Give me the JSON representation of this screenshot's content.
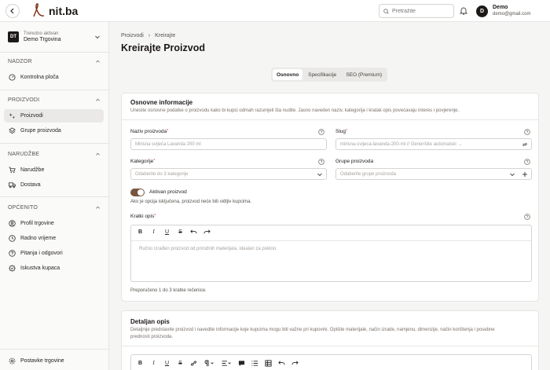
{
  "header": {
    "logo_text": "nit.ba",
    "search_placeholder": "Pretražite",
    "user_initial": "D",
    "user_name": "Demo",
    "user_email": "demo@gmail.com"
  },
  "sidebar": {
    "store_caption": "Trenutno aktivan",
    "store_name": "Demo Trgovina",
    "store_badge": "DT",
    "sections": [
      {
        "title": "NADZOR",
        "items": [
          {
            "label": "Kontrolna ploča",
            "icon": "gauge-icon"
          }
        ]
      },
      {
        "title": "PROIZVODI",
        "items": [
          {
            "label": "Proizvodi",
            "icon": "sparkle-icon",
            "active": true
          },
          {
            "label": "Grupe proizvoda",
            "icon": "layers-icon"
          }
        ]
      },
      {
        "title": "NARUDŽBE",
        "items": [
          {
            "label": "Narudžbe",
            "icon": "cart-icon"
          },
          {
            "label": "Dostava",
            "icon": "truck-icon"
          }
        ]
      },
      {
        "title": "OPĆENITO",
        "items": [
          {
            "label": "Profil trgovine",
            "icon": "user-circle-icon"
          },
          {
            "label": "Radno vrijeme",
            "icon": "clock-icon"
          },
          {
            "label": "Pitanja i odgovori",
            "icon": "question-icon"
          },
          {
            "label": "Iskustva kupaca",
            "icon": "badge-icon"
          }
        ]
      }
    ],
    "settings_label": "Postavke trgovine"
  },
  "main": {
    "breadcrumb": [
      "Proizvodi",
      "Kreirajte"
    ],
    "title": "Kreirajte Proizvod",
    "tabs": [
      {
        "label": "Osnovno",
        "active": true
      },
      {
        "label": "Specifikacije"
      },
      {
        "label": "SEO (Premium)"
      }
    ],
    "basic_card": {
      "title": "Osnovne informacije",
      "desc": "Unesite osnovne podatke o proizvodu kako bi kupci odmah razumjeli šta nudite. Jasno naveden naziv, kategorija i kratak opis povećavaju interes i povjerenje.",
      "name_label": "Naziv proizvoda",
      "name_placeholder": "Mirisna svijeća Lavanda 200 ml",
      "slug_label": "Slug",
      "slug_placeholder": "mirisna-svijeca-lavanda-200-ml  //  Generišite automatski →",
      "category_label": "Kategorije",
      "category_placeholder": "Odaberite do 3 kategorije",
      "group_label": "Grupe proizvoda",
      "group_placeholder": "Odaberite grupe proizvoda",
      "active_label": "Aktivan proizvod",
      "active_hint": "Ako je opcija isključena, proizvod neće biti vidljiv kupcima.",
      "active_on": true,
      "short_desc_label": "Kratki opis",
      "short_desc_placeholder": "Ručno izrađen proizvod od prirodnih materijala, idealan za poklon.",
      "short_desc_hint": "Preporučeno 1 do 3 kratke rečenice."
    },
    "detail_card": {
      "title": "Detaljan opis",
      "desc_line1": "Detaljnije predstavite proizvod i navedite informacije koje kupcima mogu biti važne pri kupovini. Opišite materijale, način izrade, namjenu, dimenzije, način korištenja i posebne",
      "desc_line2": "prednosti proizvoda."
    }
  }
}
